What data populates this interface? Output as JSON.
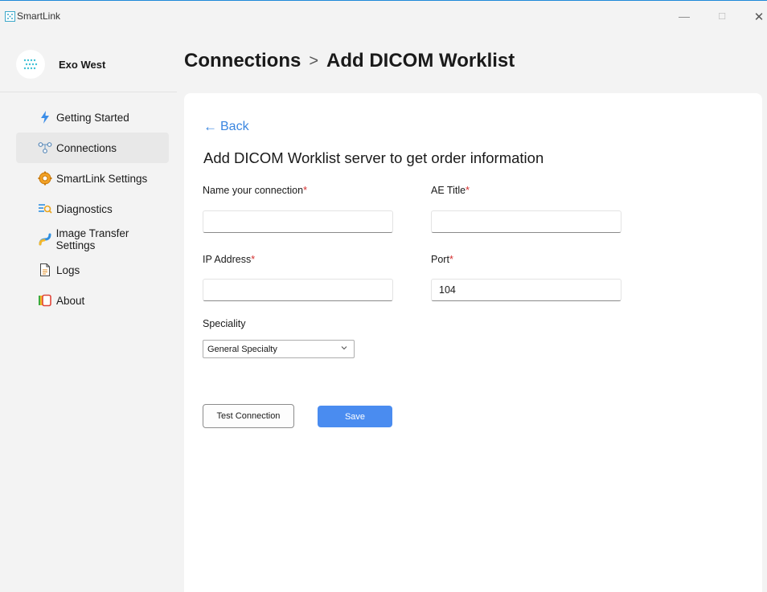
{
  "window": {
    "title": "SmartLink",
    "minimize": "—",
    "maximize": "☐",
    "close": "✕"
  },
  "sidebar": {
    "profile_name": "Exo West",
    "items": [
      {
        "label": "Getting Started",
        "icon": "lightning-icon",
        "active": false
      },
      {
        "label": "Connections",
        "icon": "network-icon",
        "active": true
      },
      {
        "label": "SmartLink Settings",
        "icon": "gear-icon",
        "active": false
      },
      {
        "label": "Diagnostics",
        "icon": "diagnostics-icon",
        "active": false
      },
      {
        "label": "Image Transfer Settings",
        "icon": "transfer-icon",
        "active": false
      },
      {
        "label": "Logs",
        "icon": "document-icon",
        "active": false
      },
      {
        "label": "About",
        "icon": "about-icon",
        "active": false
      }
    ]
  },
  "header": {
    "breadcrumb_parent": "Connections",
    "breadcrumb_separator": ">",
    "breadcrumb_current": "Add DICOM Worklist"
  },
  "form": {
    "back_label": "Back",
    "heading": "Add DICOM Worklist server to get order information",
    "required_marker": "*",
    "connection_name": {
      "label": "Name your connection",
      "value": ""
    },
    "ae_title": {
      "label": "AE Title",
      "value": ""
    },
    "ip_address": {
      "label": "IP Address",
      "value": ""
    },
    "port": {
      "label": "Port",
      "value": "104"
    },
    "speciality": {
      "label": "Speciality",
      "selected": "General Specialty"
    },
    "test_button": "Test Connection",
    "save_button": "Save"
  },
  "colors": {
    "accent": "#3a86e0",
    "save_button": "#4a8cf0",
    "required": "#d32f2f",
    "active_marker": "#1e6fd9"
  }
}
